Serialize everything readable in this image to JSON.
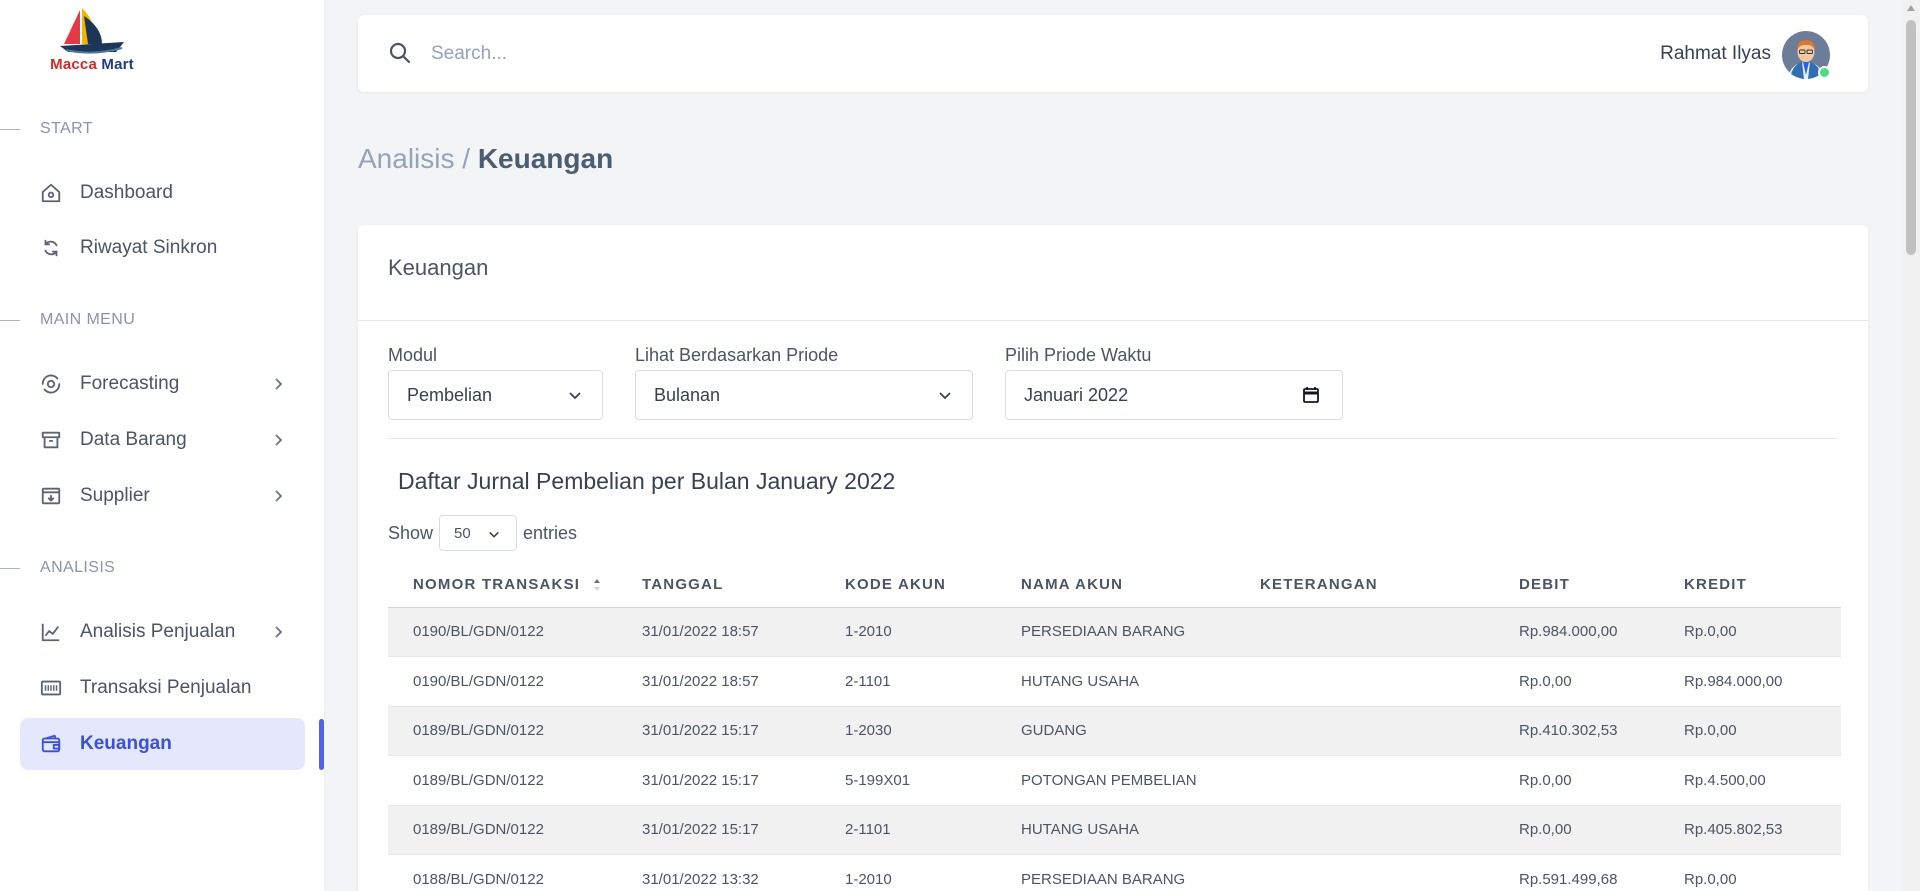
{
  "brand": {
    "name_part1": "Macca",
    "name_part2": "Mart"
  },
  "sidebar": {
    "sections": [
      {
        "label": "START"
      },
      {
        "label": "MAIN MENU"
      },
      {
        "label": "ANALISIS"
      }
    ],
    "items": [
      {
        "label": "Dashboard",
        "icon": "home-icon"
      },
      {
        "label": "Riwayat Sinkron",
        "icon": "sync-icon"
      },
      {
        "label": "Forecasting",
        "icon": "forecast-icon",
        "has_submenu": true
      },
      {
        "label": "Data Barang",
        "icon": "archive-icon",
        "has_submenu": true
      },
      {
        "label": "Supplier",
        "icon": "supplier-icon",
        "has_submenu": true
      },
      {
        "label": "Analisis Penjualan",
        "icon": "line-chart-icon",
        "has_submenu": true
      },
      {
        "label": "Transaksi Penjualan",
        "icon": "barcode-icon"
      },
      {
        "label": "Keuangan",
        "icon": "wallet-icon",
        "active": true
      }
    ]
  },
  "search": {
    "placeholder": "Search..."
  },
  "user": {
    "name": "Rahmat Ilyas",
    "status": "online"
  },
  "breadcrumb": {
    "parent": "Analisis",
    "separator": " / ",
    "current": "Keuangan"
  },
  "card": {
    "title": "Keuangan",
    "filters": {
      "modul": {
        "label": "Modul",
        "value": "Pembelian"
      },
      "periode": {
        "label": "Lihat Berdasarkan Priode",
        "value": "Bulanan"
      },
      "waktu": {
        "label": "Pilih Priode Waktu",
        "value": "Januari 2022"
      }
    },
    "table_title": "Daftar Jurnal Pembelian per Bulan January 2022",
    "show": {
      "prefix": "Show",
      "value": "50",
      "suffix": "entries"
    },
    "columns": [
      "NOMOR TRANSAKSI",
      "TANGGAL",
      "KODE AKUN",
      "NAMA AKUN",
      "KETERANGAN",
      "DEBIT",
      "KREDIT"
    ],
    "rows": [
      [
        "0190/BL/GDN/0122",
        "31/01/2022 18:57",
        "1-2010",
        "PERSEDIAAN BARANG",
        "",
        "Rp.984.000,00",
        "Rp.0,00"
      ],
      [
        "0190/BL/GDN/0122",
        "31/01/2022 18:57",
        "2-1101",
        "HUTANG USAHA",
        "",
        "Rp.0,00",
        "Rp.984.000,00"
      ],
      [
        "0189/BL/GDN/0122",
        "31/01/2022 15:17",
        "1-2030",
        "GUDANG",
        "",
        "Rp.410.302,53",
        "Rp.0,00"
      ],
      [
        "0189/BL/GDN/0122",
        "31/01/2022 15:17",
        "5-199X01",
        "POTONGAN PEMBELIAN",
        "",
        "Rp.0,00",
        "Rp.4.500,00"
      ],
      [
        "0189/BL/GDN/0122",
        "31/01/2022 15:17",
        "2-1101",
        "HUTANG USAHA",
        "",
        "Rp.0,00",
        "Rp.405.802,53"
      ],
      [
        "0188/BL/GDN/0122",
        "31/01/2022 13:32",
        "1-2010",
        "PERSEDIAAN BARANG",
        "",
        "Rp.591.499,68",
        "Rp.0,00"
      ]
    ]
  },
  "colors": {
    "accent": "#3b4fd8",
    "active_bg": "#e5e8fd",
    "page_bg": "#f3f4f6",
    "online": "#4ade80"
  }
}
